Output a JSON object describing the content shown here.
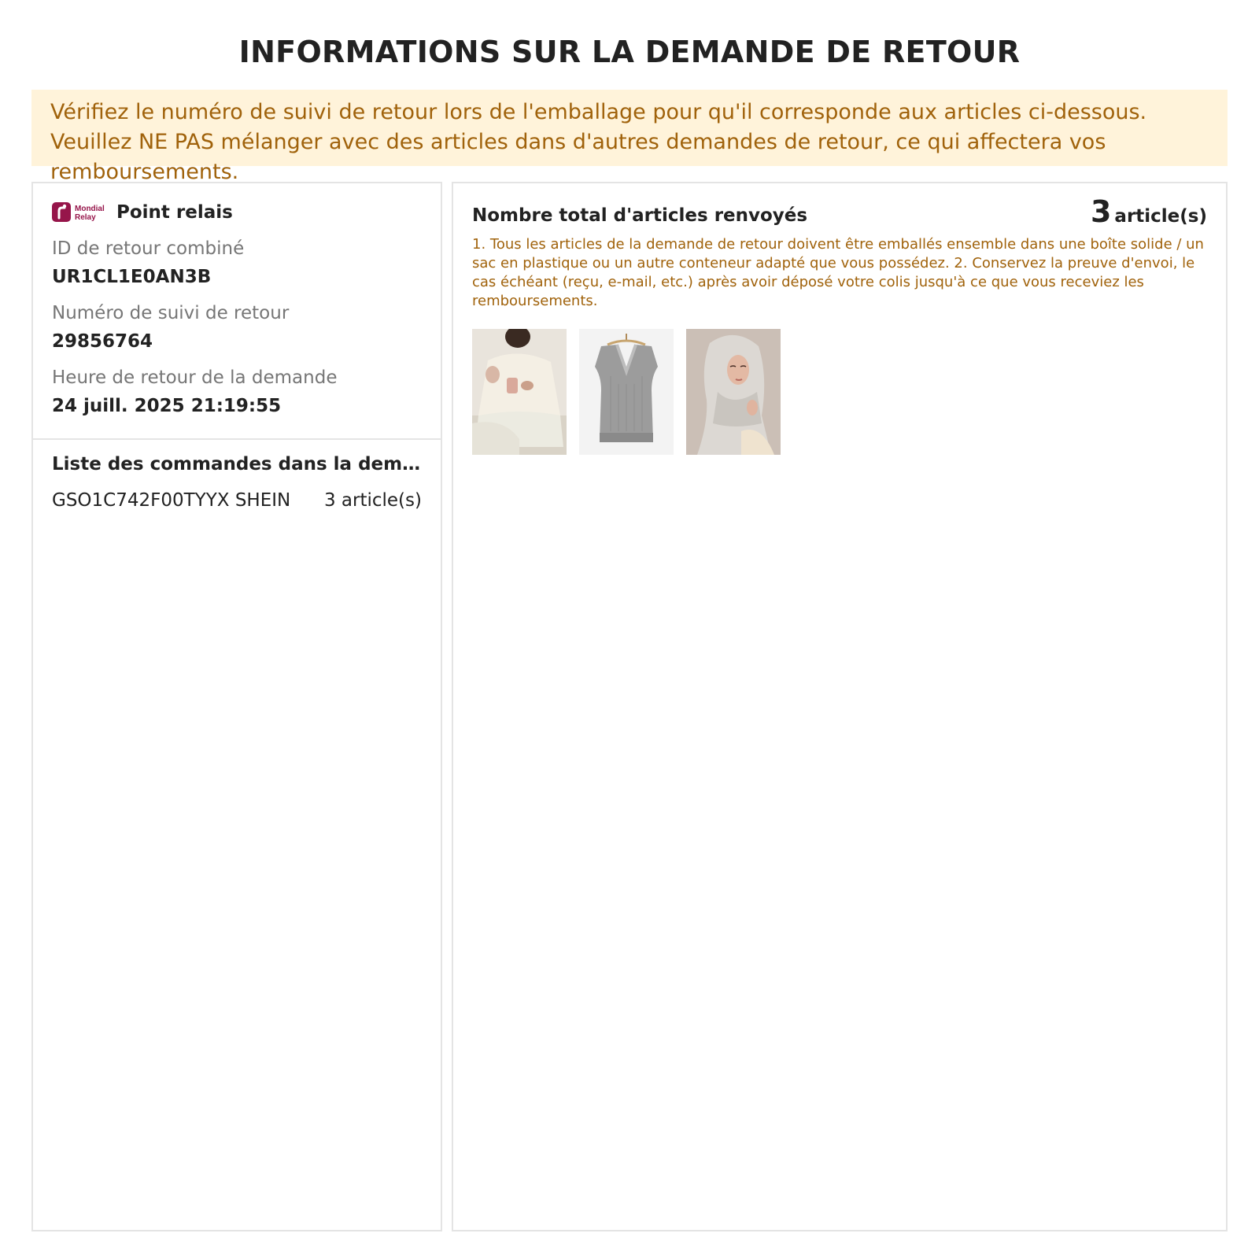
{
  "page": {
    "title": "INFORMATIONS SUR LA DEMANDE DE RETOUR"
  },
  "notice": {
    "text": "Vérifiez le numéro de suivi de retour lors de l'emballage pour qu'il corresponde aux articles ci-dessous. Veuillez NE PAS mélanger avec des articles dans d'autres demandes de retour, ce qui affectera vos remboursements."
  },
  "shipping": {
    "carrier_logo_text": [
      "Mondial",
      "Relay"
    ],
    "method": "Point relais",
    "combined_id_label": "ID de retour combiné",
    "combined_id": "UR1CL1E0AN3B",
    "tracking_label": "Numéro de suivi de retour",
    "tracking_number": "29856764",
    "request_time_label": "Heure de retour de la demande",
    "request_time": "24 juill. 2025 21:19:55"
  },
  "orders": {
    "title": "Liste des commandes dans la demande de retour",
    "items": [
      {
        "id": "GSO1C742F00TYYX SHEIN",
        "count": "3 article(s)"
      }
    ]
  },
  "summary": {
    "total_label": "Nombre total d'articles renvoyés",
    "total_count": "3",
    "total_unit": "article(s)",
    "instructions": "1. Tous les articles de la demande de retour doivent être emballés ensemble dans une boîte solide / un sac en plastique ou un autre conteneur adapté que vous possédez. 2. Conservez la preuve d'envoi, le cas échéant (reçu, e-mail, etc.) après avoir déposé votre colis jusqu'à ce que vous receviez les remboursements."
  },
  "products": [
    {
      "icon": "cream-sweater-product-image"
    },
    {
      "icon": "grey-knit-vest-product-image"
    },
    {
      "icon": "grey-hijab-product-image"
    }
  ],
  "colors": {
    "notice_bg": "#fff3da",
    "notice_text": "#a0620b",
    "brand_mondial_relay": "#96154a",
    "border": "#e4e4e4"
  }
}
